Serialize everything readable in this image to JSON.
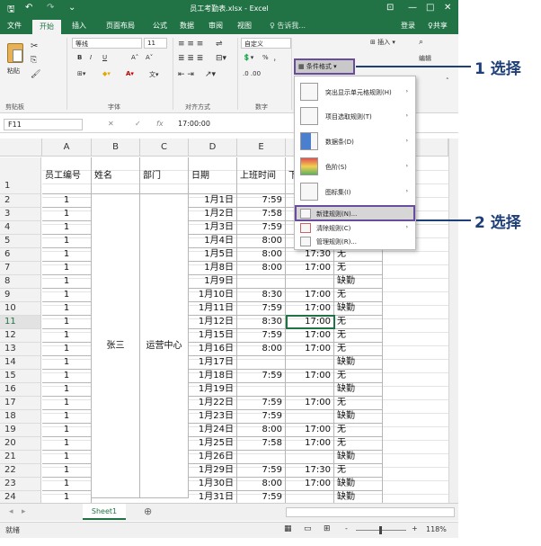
{
  "window": {
    "title": "员工考勤表.xlsx - Excel",
    "qa_save": "🖫",
    "qa_undo": "↶",
    "qa_redo": "↷",
    "qa_customize": "⌄",
    "win_opts": "⊡",
    "win_min": "—",
    "win_max": "□",
    "win_close": "✕"
  },
  "tabs": [
    "文件",
    "开始",
    "插入",
    "页面布局",
    "公式",
    "数据",
    "审阅",
    "视图"
  ],
  "active_tab": "开始",
  "tellme": "♀ 告诉我...",
  "login": "登录",
  "share": "♀共享",
  "ribbon": {
    "paste": "粘贴",
    "clipboard": "剪贴板",
    "font_name": "等线",
    "font_size": "11",
    "font": "字体",
    "align": "对齐方式",
    "number_format": "自定义",
    "number": "数字",
    "cond_format": "条件格式",
    "insert": "插入",
    "edit": "编辑",
    "bold": "B",
    "italic": "I",
    "underline": "U",
    "grow": "A˄",
    "shrink": "A˅",
    "percent": "%",
    "comma": "，"
  },
  "formula_bar": {
    "name_box": "F11",
    "cancel": "✕",
    "enter": "✓",
    "fx": "fx",
    "content": "17:00:00"
  },
  "columns": [
    "A",
    "B",
    "C",
    "D",
    "E"
  ],
  "header_row": {
    "a": "员工编号",
    "b": "姓名",
    "c": "部门",
    "d": "日期",
    "e": "上班时间",
    "f": "下"
  },
  "rows": [
    {
      "n": "2",
      "id": "1",
      "date": "1月1日",
      "in": "7:59",
      "out": "",
      "note": ""
    },
    {
      "n": "3",
      "id": "1",
      "date": "1月2日",
      "in": "7:58",
      "out": "",
      "note": ""
    },
    {
      "n": "4",
      "id": "1",
      "date": "1月3日",
      "in": "7:59",
      "out": "",
      "note": ""
    },
    {
      "n": "5",
      "id": "1",
      "date": "1月4日",
      "in": "8:00",
      "out": "",
      "note": ""
    },
    {
      "n": "6",
      "id": "1",
      "date": "1月5日",
      "in": "8:00",
      "out": "17:30",
      "note": "无"
    },
    {
      "n": "7",
      "id": "1",
      "date": "1月8日",
      "in": "8:00",
      "out": "17:00",
      "note": "无"
    },
    {
      "n": "8",
      "id": "1",
      "date": "1月9日",
      "in": "",
      "out": "",
      "note": "缺勤"
    },
    {
      "n": "9",
      "id": "1",
      "date": "1月10日",
      "in": "8:30",
      "out": "17:00",
      "note": "无"
    },
    {
      "n": "10",
      "id": "1",
      "date": "1月11日",
      "in": "7:59",
      "out": "17:00",
      "note": "缺勤"
    },
    {
      "n": "11",
      "id": "1",
      "date": "1月12日",
      "in": "8:30",
      "out": "17:00",
      "note": "无"
    },
    {
      "n": "12",
      "id": "1",
      "date": "1月15日",
      "in": "7:59",
      "out": "17:00",
      "note": "无"
    },
    {
      "n": "13",
      "id": "1",
      "date": "1月16日",
      "in": "8:00",
      "out": "17:00",
      "note": "无"
    },
    {
      "n": "14",
      "id": "1",
      "date": "1月17日",
      "in": "",
      "out": "",
      "note": "缺勤"
    },
    {
      "n": "15",
      "id": "1",
      "date": "1月18日",
      "in": "7:59",
      "out": "17:00",
      "note": "无"
    },
    {
      "n": "16",
      "id": "1",
      "date": "1月19日",
      "in": "",
      "out": "",
      "note": "缺勤"
    },
    {
      "n": "17",
      "id": "1",
      "date": "1月22日",
      "in": "7:59",
      "out": "17:00",
      "note": "无"
    },
    {
      "n": "18",
      "id": "1",
      "date": "1月23日",
      "in": "7:59",
      "out": "",
      "note": "缺勤"
    },
    {
      "n": "19",
      "id": "1",
      "date": "1月24日",
      "in": "8:00",
      "out": "17:00",
      "note": "无"
    },
    {
      "n": "20",
      "id": "1",
      "date": "1月25日",
      "in": "7:58",
      "out": "17:00",
      "note": "无"
    },
    {
      "n": "21",
      "id": "1",
      "date": "1月26日",
      "in": "",
      "out": "",
      "note": "缺勤"
    },
    {
      "n": "22",
      "id": "1",
      "date": "1月29日",
      "in": "7:59",
      "out": "17:30",
      "note": "无"
    },
    {
      "n": "23",
      "id": "1",
      "date": "1月30日",
      "in": "8:00",
      "out": "17:00",
      "note": "缺勤"
    },
    {
      "n": "24",
      "id": "1",
      "date": "1月31日",
      "in": "7:59",
      "out": "",
      "note": "缺勤"
    }
  ],
  "merged": {
    "name": "张三",
    "dept": "运营中心"
  },
  "dropdown": {
    "items": [
      {
        "label": "突出显示单元格规则(H)",
        "arrow": "›"
      },
      {
        "label": "项目选取规则(T)",
        "arrow": "›"
      },
      {
        "label": "数据条(D)",
        "arrow": "›"
      },
      {
        "label": "色阶(S)",
        "arrow": "›"
      },
      {
        "label": "图标集(I)",
        "arrow": "›"
      },
      {
        "label": "新建规则(N)...",
        "arrow": ""
      },
      {
        "label": "清除规则(C)",
        "arrow": "›"
      },
      {
        "label": "管理规则(R)...",
        "arrow": ""
      }
    ]
  },
  "callouts": {
    "step1": "1 选择",
    "step2": "2 选择"
  },
  "sheet": {
    "name": "Sheet1",
    "add": "⊕"
  },
  "status": {
    "ready": "就绪",
    "zoom": "118%",
    "minus": "-",
    "plus": "+"
  },
  "colors": {
    "excel_green": "#217346",
    "callout_blue": "#1e3f78",
    "highlight_purple": "#6a4c9c"
  }
}
